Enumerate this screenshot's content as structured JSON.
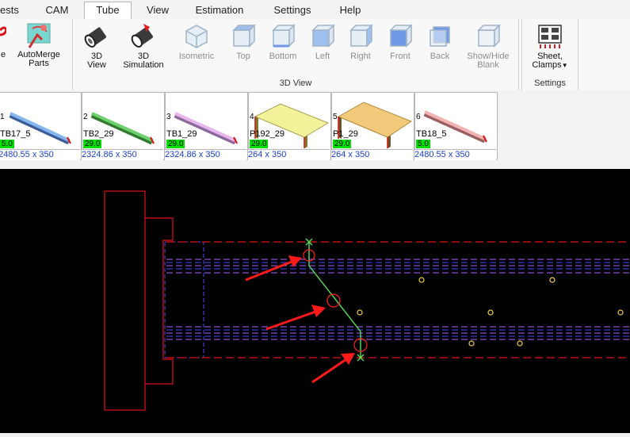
{
  "menu": {
    "tabs": [
      {
        "label": "ests",
        "active": false
      },
      {
        "label": "CAM",
        "active": false
      },
      {
        "label": "Tube",
        "active": true
      },
      {
        "label": "View",
        "active": false
      },
      {
        "label": "Estimation",
        "active": false
      },
      {
        "label": "Settings",
        "active": false
      },
      {
        "label": "Help",
        "active": false
      }
    ]
  },
  "ribbon": {
    "automerge": {
      "line1": "AutoMerge",
      "line2": "Parts"
    },
    "partial_left": "e",
    "view3d": {
      "label": "3D View",
      "buttons": [
        {
          "line1": "3D",
          "line2": "View",
          "enabled": true
        },
        {
          "line1": "3D",
          "line2": "Simulation",
          "enabled": true
        },
        {
          "line1": "Isometric",
          "line2": "",
          "enabled": false
        },
        {
          "line1": "Top",
          "line2": "",
          "enabled": false
        },
        {
          "line1": "Bottom",
          "line2": "",
          "enabled": false
        },
        {
          "line1": "Left",
          "line2": "",
          "enabled": false
        },
        {
          "line1": "Right",
          "line2": "",
          "enabled": false
        },
        {
          "line1": "Front",
          "line2": "",
          "enabled": false
        },
        {
          "line1": "Back",
          "line2": "",
          "enabled": false
        },
        {
          "line1": "Show/Hide",
          "line2": "Blank",
          "enabled": false
        }
      ]
    },
    "settings": {
      "label": "Settings",
      "button": {
        "line1": "Sheet,",
        "line2": "Clamps"
      }
    }
  },
  "parts": [
    {
      "num": "1",
      "name": "TB17_5",
      "badge": "5.0",
      "dims": "2480.55 x 350",
      "color": "#86b6f0"
    },
    {
      "num": "2",
      "name": "TB2_29",
      "badge": "29.0",
      "dims": "2324.86 x 350",
      "color": "#6cd06c"
    },
    {
      "num": "3",
      "name": "TB1_29",
      "badge": "29.0",
      "dims": "2324.86 x 350",
      "color": "#e7b6ec"
    },
    {
      "num": "4",
      "name": "P192_29",
      "badge": "29.0",
      "dims": "264 x 350",
      "color": "#f2f29a"
    },
    {
      "num": "5",
      "name": "P1_29",
      "badge": "29.0",
      "dims": "264 x 350",
      "color": "#f2c87a"
    },
    {
      "num": "6",
      "name": "TB18_5",
      "badge": "5.0",
      "dims": "2480.55 x 350",
      "color": "#f2b2b2"
    }
  ],
  "colors": {
    "canvas_bg": "#000000",
    "outline_red": "#e0101a",
    "dash_blue": "#4a4aff",
    "dash_purple": "#b060ff",
    "path_green": "#55e055",
    "marker_yellow": "#f0d040",
    "arrow_red": "#ff1a1a"
  }
}
